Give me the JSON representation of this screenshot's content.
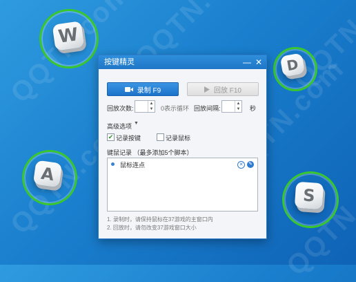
{
  "watermark": "QQTN.com",
  "keys": [
    "W",
    "D",
    "A",
    "S"
  ],
  "window": {
    "title": "按键精灵",
    "minimize_glyph": "—",
    "close_glyph": "✕"
  },
  "buttons": {
    "record_label": "录制 F9",
    "play_label": "回放 F10"
  },
  "settings": {
    "repeat_label": "回放次数:",
    "repeat_hint": "0表示循环",
    "interval_label": "回放间隔:",
    "interval_unit": "秒"
  },
  "advanced": {
    "title": "高级选项",
    "record_keys_label": "记录按键",
    "record_keys_checked": true,
    "record_mouse_label": "记录鼠标",
    "record_mouse_checked": false
  },
  "records": {
    "title": "键鼠记录 （最多添加5个脚本）",
    "items": [
      {
        "label": "鼠标连点"
      }
    ]
  },
  "notes": [
    "1. 录制时，请保持鼠标在37游戏的主窗口内",
    "2. 回放时，请勿改变37游戏窗口大小"
  ],
  "colors": {
    "accent": "#1f76c8",
    "ring": "#38c72f"
  }
}
